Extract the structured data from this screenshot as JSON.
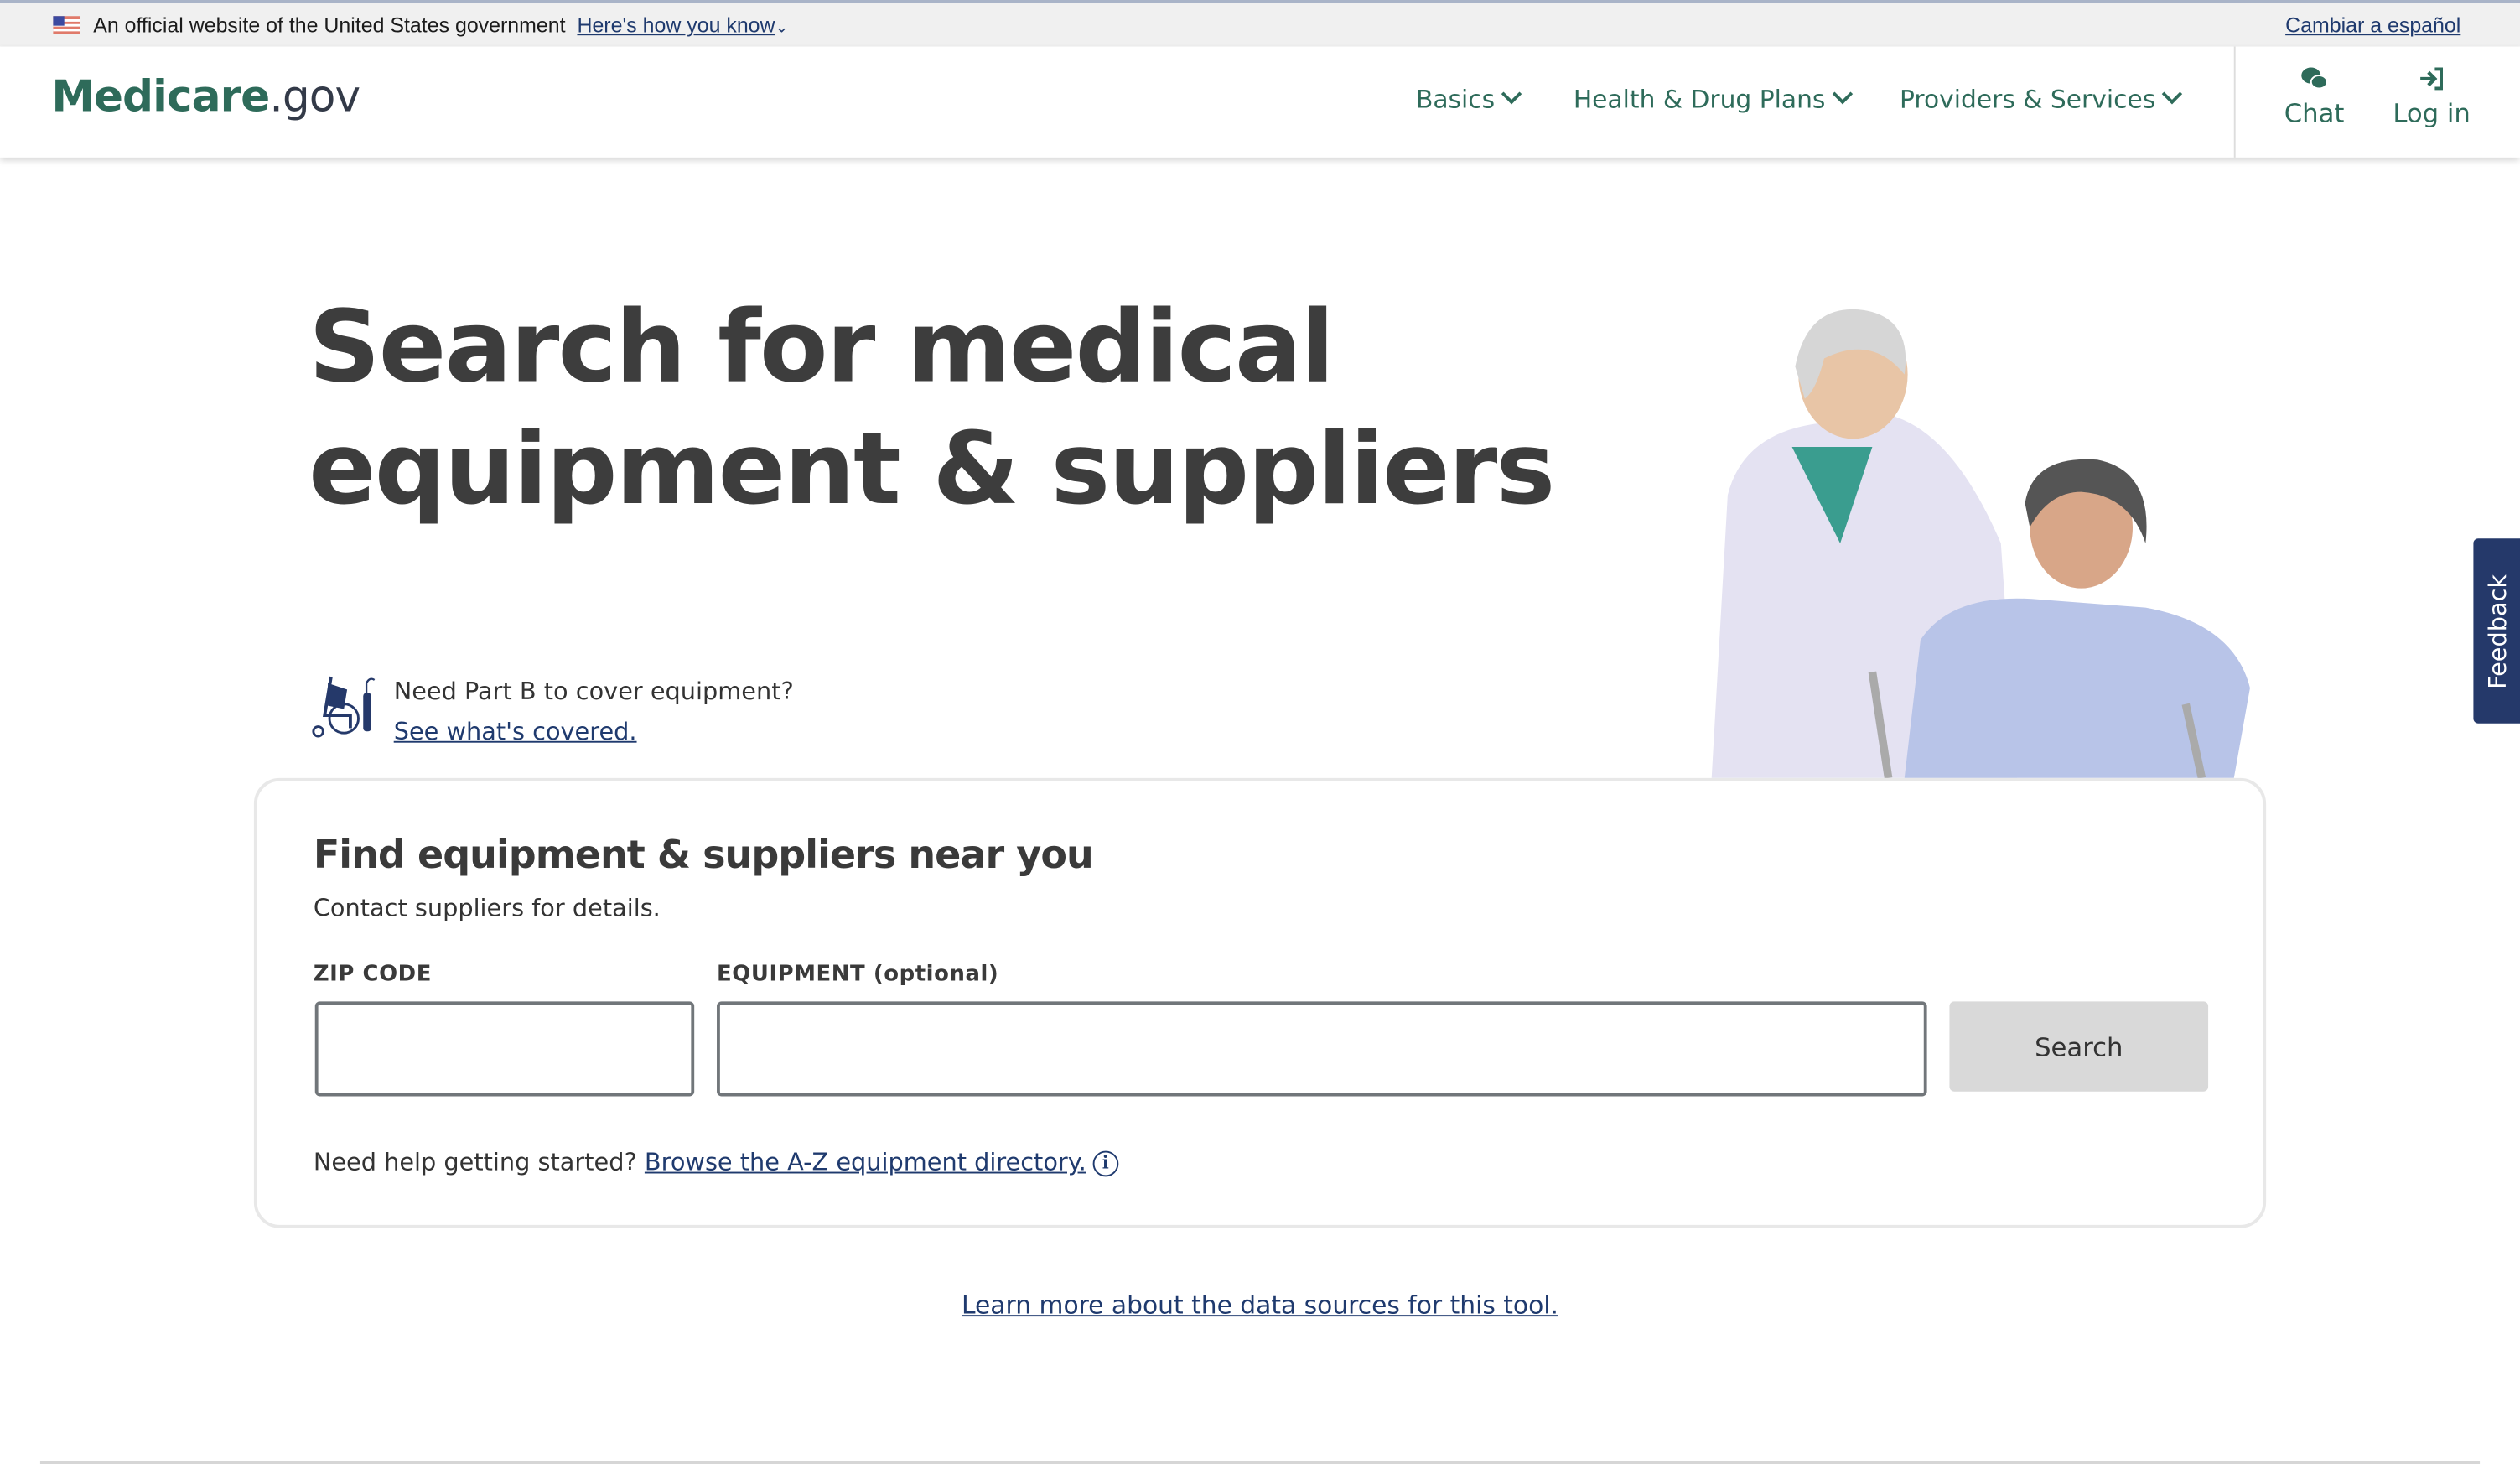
{
  "gov_banner": {
    "text": "An official website of the United States government",
    "how_you_know": "Here's how you know",
    "language_link": "Cambiar a español"
  },
  "header": {
    "logo_main": "Medicare",
    "logo_suffix": ".gov",
    "nav": [
      {
        "label": "Basics"
      },
      {
        "label": "Health & Drug Plans"
      },
      {
        "label": "Providers & Services"
      }
    ],
    "chat_label": "Chat",
    "login_label": "Log in"
  },
  "hero": {
    "title_line1": "Search for medical",
    "title_line2": "equipment & suppliers",
    "partb_question": "Need Part B to cover equipment?",
    "partb_link": "See what's covered."
  },
  "search_card": {
    "heading": "Find equipment & suppliers near you",
    "subtext": "Contact suppliers for details.",
    "zip_label": "ZIP CODE",
    "zip_value": "",
    "equipment_label": "EQUIPMENT (optional)",
    "equipment_value": "",
    "search_button": "Search",
    "help_text": "Need help getting started?",
    "help_link": "Browse the A-Z equipment directory."
  },
  "learn_more_link": "Learn more about the data sources for this tool.",
  "feedback_label": "Feedback",
  "colors": {
    "brand_green": "#2e6b5a",
    "link_blue": "#1f3a6e",
    "feedback_bg": "#25396a"
  }
}
